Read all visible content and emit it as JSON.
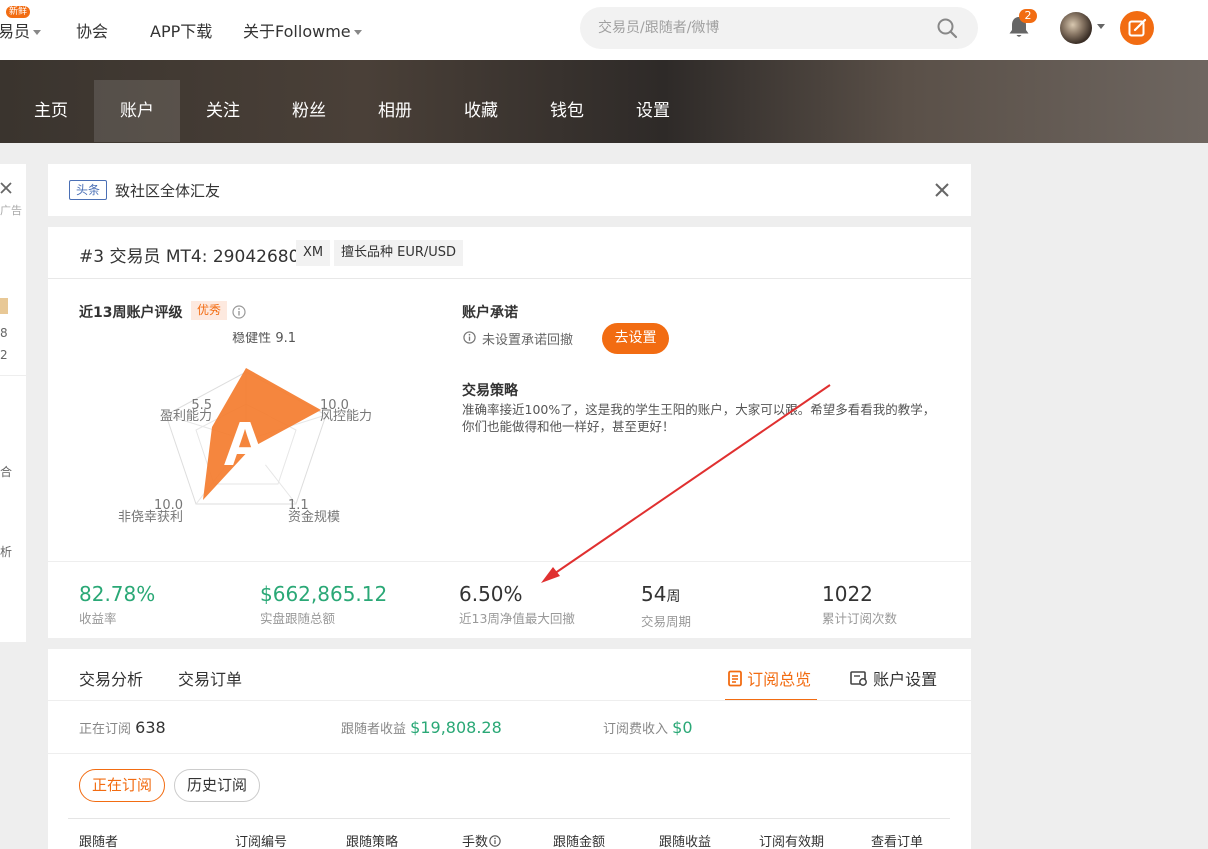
{
  "topbar": {
    "nav_partial": "易员",
    "nav_new_badge": "新鲜",
    "nav_association": "协会",
    "nav_app": "APP下载",
    "nav_about": "关于Followme",
    "search_placeholder": "交易员/跟随者/微博",
    "notifications_count": "2"
  },
  "main_nav": {
    "tabs": [
      {
        "label": "主页"
      },
      {
        "label": "账户"
      },
      {
        "label": "关注"
      },
      {
        "label": "粉丝"
      },
      {
        "label": "相册"
      },
      {
        "label": "收藏"
      },
      {
        "label": "钱包"
      },
      {
        "label": "设置"
      }
    ],
    "active": "账户"
  },
  "left_strip": {
    "ad": "广告",
    "n1": "8",
    "n2": "2",
    "c1": "合",
    "c2": "析"
  },
  "notice": {
    "tag": "头条",
    "text": "致社区全体汇友"
  },
  "trader": {
    "rank": "#3 交易员 MT4: 29042680",
    "broker": "XM",
    "specialty": "擅长品种 EUR/USD",
    "rating_title": "近13周账户评级",
    "rating_badge": "优秀",
    "grade": "A",
    "radar": {
      "stability_label": "稳健性",
      "stability": "9.1",
      "risk_label": "风控能力",
      "risk": "10.0",
      "scale_label": "资金规模",
      "scale": "1.1",
      "nonluck_label": "非侥幸获利",
      "nonluck": "10.0",
      "profit_label": "盈利能力",
      "profit": "5.5"
    },
    "promise_title": "账户承诺",
    "promise_text": "未设置承诺回撤",
    "promise_button": "去设置",
    "strategy_title": "交易策略",
    "strategy_text": "准确率接近100%了，这是我的学生王阳的账户，大家可以跟。希望多看看我的教学，你们也能做得和他一样好，甚至更好！",
    "stats": [
      {
        "value": "82.78%",
        "label": "收益率"
      },
      {
        "value": "$662,865.12",
        "label": "实盘跟随总额"
      },
      {
        "value": "6.50%",
        "label": "近13周净值最大回撤"
      },
      {
        "value": "54",
        "unit": "周",
        "label": "交易周期"
      },
      {
        "value": "1022",
        "label": "累计订阅次数"
      }
    ]
  },
  "subscription": {
    "tab_analysis": "交易分析",
    "tab_orders": "交易订单",
    "tab_overview": "订阅总览",
    "tab_settings": "账户设置",
    "subscribing_label": "正在订阅",
    "subscribing_value": "638",
    "follower_income_label": "跟随者收益",
    "follower_income_value": "$19,808.28",
    "fee_income_label": "订阅费收入",
    "fee_income_value": "$0",
    "btn_current": "正在订阅",
    "btn_history": "历史订阅",
    "columns": [
      "跟随者",
      "订阅编号",
      "跟随策略",
      "手数",
      "跟随金额",
      "跟随收益",
      "订阅有效期",
      "查看订单"
    ]
  }
}
